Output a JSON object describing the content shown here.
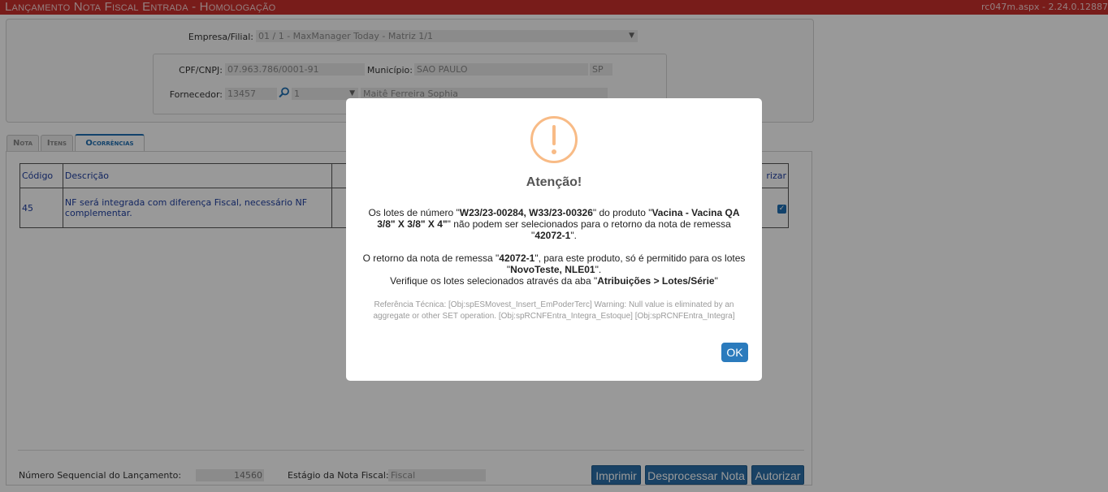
{
  "header": {
    "title": "Lançamento Nota Fiscal Entrada  - Homologação",
    "version": "rc047m.aspx - 2.24.0.12887"
  },
  "form": {
    "empresa_label": "Empresa/Filial:",
    "empresa_value": "01 / 1 - MaxManager Today - Matriz 1/1",
    "cpf_label": "CPF/CNPJ:",
    "cpf_value": "07.963.786/0001-91",
    "municipio_label": "Município:",
    "municipio_value": "SAO PAULO",
    "uf_value": "SP",
    "fornecedor_label": "Fornecedor:",
    "fornecedor_code": "13457",
    "fornecedor_seq": "1",
    "fornecedor_name": "Maitê Ferreira Sophia"
  },
  "tabs": [
    {
      "label": "Nota"
    },
    {
      "label": "Itens"
    },
    {
      "label": "Ocorrências"
    }
  ],
  "grid": {
    "headers": [
      "Código",
      "Descrição",
      "",
      "rizar"
    ],
    "rows": [
      {
        "codigo": "45",
        "descricao": "NF será integrada com diferença Fiscal, necessário NF complementar.",
        "autorizar": true
      }
    ]
  },
  "footer": {
    "seq_label": "Número Sequencial do Lançamento:",
    "seq_value": "14560",
    "estagio_label": "Estágio da Nota Fiscal:",
    "estagio_value": "Fiscal",
    "btn_imprimir": "Imprimir",
    "btn_desprocessar": "Desprocessar Nota",
    "btn_autorizar": "Autorizar"
  },
  "modal": {
    "title": "Atenção!",
    "p1_a": "Os lotes de número \"",
    "p1_lotes": "W23/23-00284, W33/23-00326",
    "p1_b": "\" do produto \"",
    "p1_produto": "Vacina - Vacina QA 3/8\" X 3/8\" X 4\"",
    "p1_c": "\" não podem ser selecionados para o retorno da nota de remessa \"",
    "p1_nota": "42072-1",
    "p1_d": "\".",
    "p2_a": "O retorno da nota de remessa \"",
    "p2_nota": "42072-1",
    "p2_b": "\", para este produto, só é permitido para os lotes \"",
    "p2_lotes": "NovoTeste, NLE01",
    "p2_c": "\".",
    "p3_a": "Verifique os lotes selecionados através da aba \"",
    "p3_aba": "Atribuições > Lotes/Série",
    "p3_b": "\"",
    "tech": "Referência Técnica: [Obj:spESMovest_Insert_EmPoderTerc] Warning: Null value is eliminated by an aggregate or other SET operation. [Obj:spRCNFEntra_Integra_Estoque] [Obj:spRCNFEntra_Integra]",
    "ok_label": "OK"
  },
  "colors": {
    "titlebar": "#c9302c",
    "primary_button": "#2b6fa8",
    "warning_icon": "#f8bb86"
  }
}
